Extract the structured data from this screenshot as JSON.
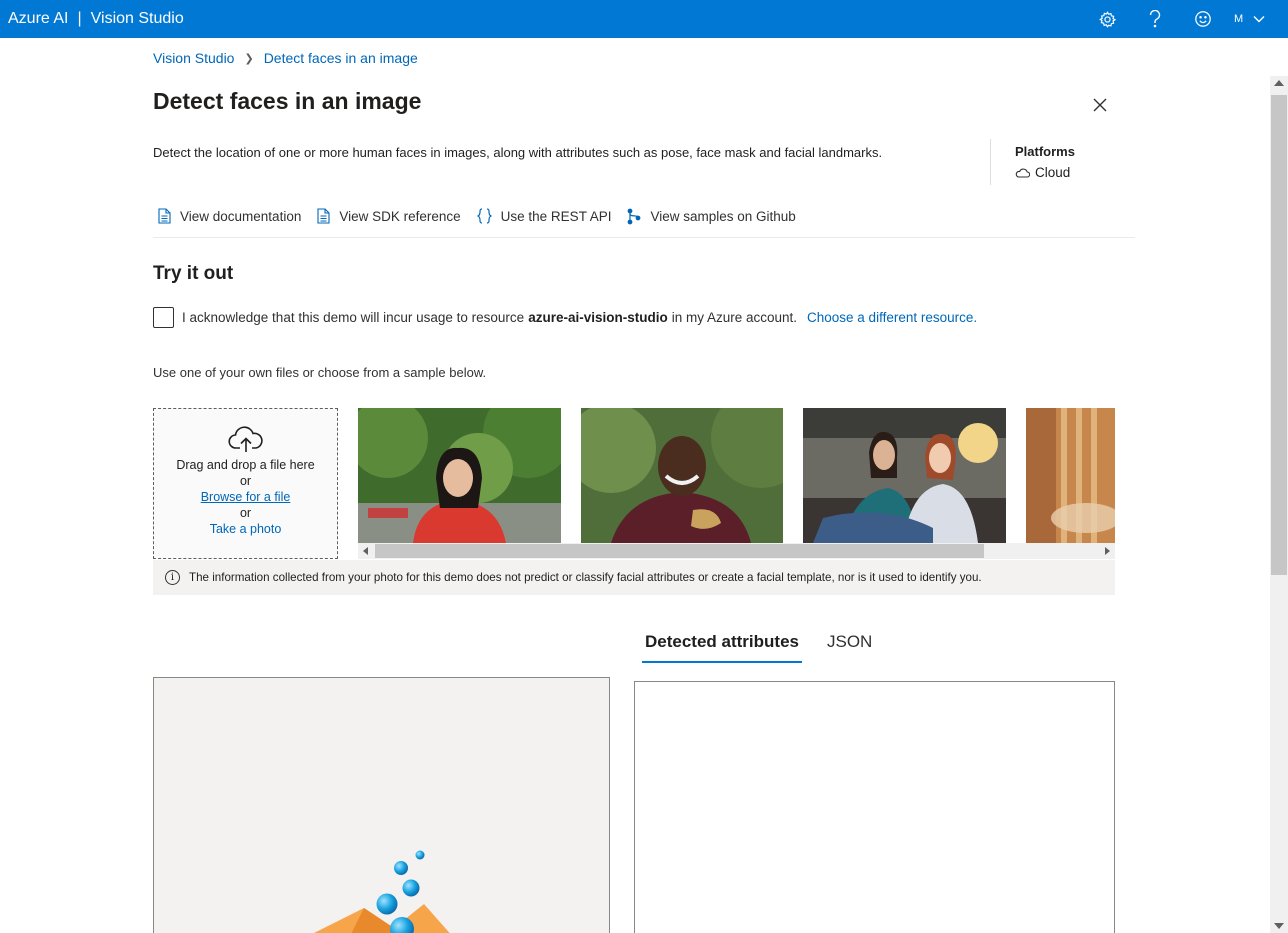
{
  "topbar": {
    "brand_left": "Azure AI",
    "brand_separator": "|",
    "brand_right": "Vision Studio",
    "icons": [
      "settings-gear-icon",
      "help-question-icon",
      "feedback-smiley-icon"
    ],
    "account_initial": "M",
    "color": "#0078d4"
  },
  "breadcrumb": {
    "items": [
      "Vision Studio",
      "Detect faces in an image"
    ]
  },
  "page": {
    "title": "Detect faces in an image",
    "description": "Detect the location of one or more human faces in images, along with attributes such as pose, face mask and facial landmarks.",
    "platforms_label": "Platforms",
    "platforms_value": "Cloud"
  },
  "links": [
    {
      "label": "View documentation",
      "icon": "document-icon"
    },
    {
      "label": "View SDK reference",
      "icon": "document-icon"
    },
    {
      "label": "Use the REST API",
      "icon": "braces-icon"
    },
    {
      "label": "View samples on Github",
      "icon": "branch-icon"
    }
  ],
  "try_it_out": {
    "title": "Try it out",
    "ack_prefix": "I acknowledge that this demo will incur usage to resource",
    "resource_name": "azure-ai-vision-studio",
    "ack_suffix": "in my Azure account.",
    "change_resource": "Choose a different resource.",
    "hint": "Use one of your own files or choose from a sample below.",
    "dropzone": {
      "drag_text": "Drag and drop a file here",
      "or_1": "or",
      "browse": "Browse for a file",
      "or_2": "or",
      "photo": "Take a photo"
    },
    "info": "The information collected from your photo for this demo does not predict or classify facial attributes or create a facial template, nor is it used to identify you."
  },
  "tabs": {
    "detected": "Detected attributes",
    "json": "JSON",
    "active": "Detected attributes"
  }
}
